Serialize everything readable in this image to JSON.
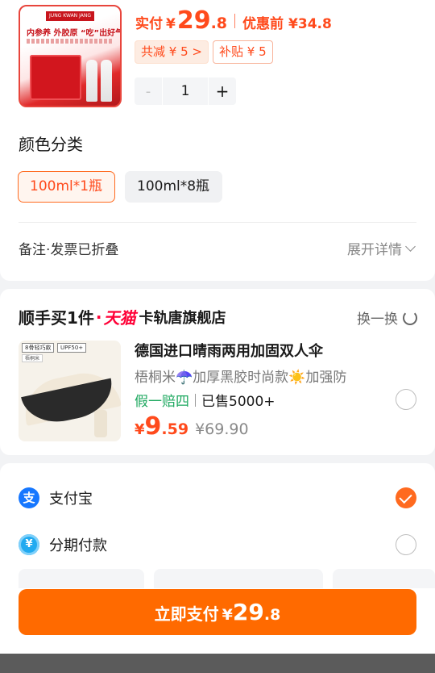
{
  "product": {
    "thumb": {
      "brand": "JUNG KWAN JANG",
      "slogan": "内参养 外胶原 “吃”出好气色"
    },
    "pay_label": "实付",
    "currency": "¥",
    "price_int": "29",
    "price_dec": ".8",
    "before_label": "优惠前",
    "before_price": "¥34.8",
    "save_tag": "共减 ¥ 5 >",
    "subsidy_tag": "补贴 ¥ 5",
    "stepper": {
      "minus": "-",
      "qty": "1",
      "plus": "+"
    }
  },
  "sku": {
    "title": "颜色分类",
    "options": [
      {
        "label": "100ml*1瓶",
        "selected": true
      },
      {
        "label": "100ml*8瓶",
        "selected": false
      }
    ]
  },
  "note": {
    "label": "备注·发票已折叠",
    "expand": "展开详情"
  },
  "deal": {
    "title_main": "顺手买1件",
    "title_dot": "·",
    "tmall": "天猫",
    "store": "卡轨唐旗舰店",
    "swap": "换一换",
    "item": {
      "thumb_tags": [
        "8骨轻巧款",
        "UPF50+",
        "梧桐米"
      ],
      "title": "德国进口晴雨两用加固双人伞",
      "desc": "梧桐米☂️加厚黑胶时尚款☀️加强防",
      "badge": "假一赔四",
      "sold": "已售5000+",
      "currency": "¥",
      "price_int": "9",
      "price_dec": ".59",
      "orig_price": "¥69.90",
      "selected": false
    }
  },
  "payment": {
    "methods": [
      {
        "name": "支付宝",
        "icon": "支",
        "selected": true
      },
      {
        "name": "分期付款",
        "icon": "¥",
        "selected": false
      }
    ],
    "button": {
      "label": "立即支付",
      "currency": "¥",
      "int": "29",
      "dec": ".8"
    }
  },
  "colors": {
    "accent": "#ff4a1c",
    "button": "#ff6a00",
    "alipay": "#1677ff",
    "green": "#1da85f"
  }
}
